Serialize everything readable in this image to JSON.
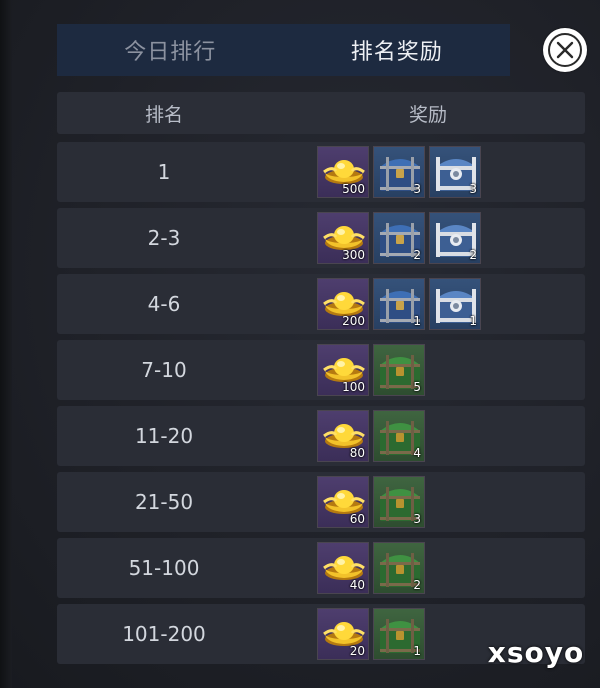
{
  "tabs": [
    {
      "label": "今日排行",
      "active": false
    },
    {
      "label": "排名奖励",
      "active": true
    }
  ],
  "header": {
    "rank": "排名",
    "reward": "奖励"
  },
  "rows": [
    {
      "rank": "1",
      "rewards": [
        {
          "icon": "gold-ingot-icon",
          "count": "500"
        },
        {
          "icon": "blue-chest-icon",
          "count": "3"
        },
        {
          "icon": "silver-chest-icon",
          "count": "3"
        }
      ]
    },
    {
      "rank": "2-3",
      "rewards": [
        {
          "icon": "gold-ingot-icon",
          "count": "300"
        },
        {
          "icon": "blue-chest-icon",
          "count": "2"
        },
        {
          "icon": "silver-chest-icon",
          "count": "2"
        }
      ]
    },
    {
      "rank": "4-6",
      "rewards": [
        {
          "icon": "gold-ingot-icon",
          "count": "200"
        },
        {
          "icon": "blue-chest-icon",
          "count": "1"
        },
        {
          "icon": "silver-chest-icon",
          "count": "1"
        }
      ]
    },
    {
      "rank": "7-10",
      "rewards": [
        {
          "icon": "gold-ingot-icon",
          "count": "100"
        },
        {
          "icon": "green-chest-icon",
          "count": "5"
        }
      ]
    },
    {
      "rank": "11-20",
      "rewards": [
        {
          "icon": "gold-ingot-icon",
          "count": "80"
        },
        {
          "icon": "green-chest-icon",
          "count": "4"
        }
      ]
    },
    {
      "rank": "21-50",
      "rewards": [
        {
          "icon": "gold-ingot-icon",
          "count": "60"
        },
        {
          "icon": "green-chest-icon",
          "count": "3"
        }
      ]
    },
    {
      "rank": "51-100",
      "rewards": [
        {
          "icon": "gold-ingot-icon",
          "count": "40"
        },
        {
          "icon": "green-chest-icon",
          "count": "2"
        }
      ]
    },
    {
      "rank": "101-200",
      "rewards": [
        {
          "icon": "gold-ingot-icon",
          "count": "20"
        },
        {
          "icon": "green-chest-icon",
          "count": "1"
        }
      ]
    }
  ],
  "watermark": "xsoyo",
  "colors": {
    "tab_bar": "#1d2a40",
    "row_bg": "#2a2d36",
    "gold_item_bg": "#4e3e6e",
    "blue_item_bg": "#35527a",
    "green_item_bg": "#3f6540"
  }
}
